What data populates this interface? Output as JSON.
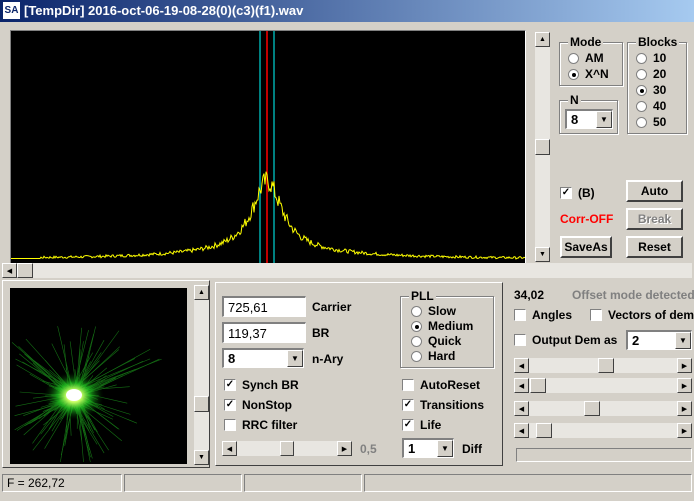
{
  "window": {
    "title": "[TempDir] 2016-oct-06-19-08-28(0)(c3)(f1).wav",
    "icon_label": "SA"
  },
  "colors": {
    "title_start": "#0a246a",
    "spectrum_bg": "#000000",
    "spectrum_line": "#ffff00",
    "marker_cyan": "#00ffff",
    "marker_red": "#ff0000",
    "constellation": "#00ff00",
    "corr_off": "#ff0000"
  },
  "mode": {
    "label": "Mode",
    "options": [
      "AM",
      "X^N"
    ],
    "selected": "X^N"
  },
  "blocks": {
    "label": "Blocks",
    "options": [
      "10",
      "20",
      "30",
      "40",
      "50"
    ],
    "selected": "30"
  },
  "n_group": {
    "label": "N",
    "value": "8"
  },
  "b_check": {
    "label": "(B)",
    "checked": true
  },
  "corr_status": "Corr-OFF",
  "buttons": {
    "auto": "Auto",
    "break": "Break",
    "saveas": "SaveAs",
    "reset": "Reset"
  },
  "carrier": {
    "value": "725,61",
    "label": "Carrier"
  },
  "br": {
    "value": "119,37",
    "label": "BR"
  },
  "nary": {
    "value": "8",
    "label": "n-Ary"
  },
  "pll": {
    "label": "PLL",
    "options": [
      "Slow",
      "Medium",
      "Quick",
      "Hard"
    ],
    "selected": "Medium"
  },
  "checks": {
    "synch_br": {
      "label": "Synch BR",
      "checked": true
    },
    "nonstop": {
      "label": "NonStop",
      "checked": true
    },
    "rrc_filter": {
      "label": "RRC filter",
      "checked": false
    },
    "autoreset": {
      "label": "AutoReset",
      "checked": false
    },
    "transitions": {
      "label": "Transitions",
      "checked": true
    },
    "life": {
      "label": "Life",
      "checked": true
    }
  },
  "slider_value": "0,5",
  "diff": {
    "value": "1",
    "label": "Diff"
  },
  "offset": {
    "value": "34,02",
    "message": "Offset mode detected"
  },
  "angles": {
    "label": "Angles",
    "checked": false
  },
  "vectors": {
    "label": "Vectors of dem",
    "checked": false
  },
  "output_dem": {
    "label": "Output Dem as",
    "checked": false,
    "value": "2"
  },
  "status": {
    "freq": "F = 262,72"
  }
}
